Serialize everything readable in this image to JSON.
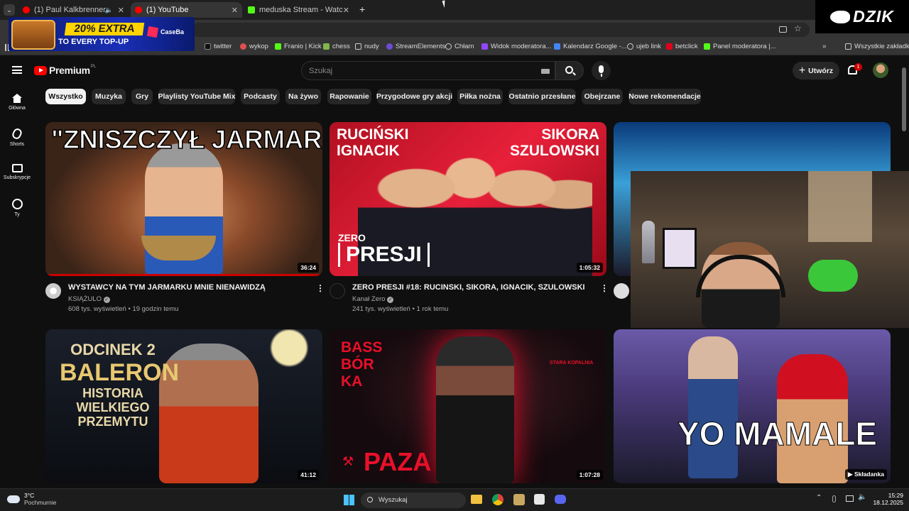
{
  "tabs": [
    {
      "label": "(1) Paul Kalkbrenner - Live a",
      "favicon_color": "#ff0000"
    },
    {
      "label": "(1) YouTube",
      "favicon_color": "#ff0000"
    },
    {
      "label": "meduska Stream - Watch Live o",
      "favicon_color": "#53fc18"
    }
  ],
  "new_tab_label": "+",
  "tab_close_glyph": "✕",
  "overlay": {
    "promo_line1": "20% EXTRA",
    "promo_line2": "TO EVERY TOP-UP",
    "promo_brand": "CaseBa",
    "corner_logo": "DZIK"
  },
  "bookmarks": [
    {
      "label": "twitter",
      "color": "#ffffff"
    },
    {
      "label": "wykop",
      "color": "#e24f4f"
    },
    {
      "label": "Franio | Kick",
      "color": "#53fc18"
    },
    {
      "label": "chess",
      "color": "#81b64c"
    },
    {
      "label": "nudy",
      "color": "#cfcfcf"
    },
    {
      "label": "StreamElements",
      "color": "#6f4bd8"
    },
    {
      "label": "Chłam",
      "color": "#cfcfcf"
    },
    {
      "label": "Widok moderatora...",
      "color": "#9146ff"
    },
    {
      "label": "Kalendarz Google -...",
      "color": "#4285f4"
    },
    {
      "label": "ujeb link",
      "color": "#cfcfcf"
    },
    {
      "label": "betclick",
      "color": "#e2001a"
    },
    {
      "label": "Panel moderatora |...",
      "color": "#53fc18"
    }
  ],
  "bookmarks_all_label": "Wszystkie zakładki",
  "youtube": {
    "logo": "Premium",
    "logo_region": "PL",
    "search_placeholder": "Szukaj",
    "create_label": "Utwórz",
    "notification_count": "1",
    "sidebar": [
      {
        "label": "Główna",
        "icon": "home-icon"
      },
      {
        "label": "Shorts",
        "icon": "shorts-icon"
      },
      {
        "label": "Subskrypcje",
        "icon": "subscriptions-icon"
      },
      {
        "label": "Ty",
        "icon": "you-icon"
      }
    ],
    "chips": [
      "Wszystko",
      "Muzyka",
      "Gry",
      "Playlisty YouTube Mix",
      "Podcasty",
      "Na żywo",
      "Rapowanie",
      "Przygodowe gry akcji",
      "Piłka nożna",
      "Ostatnio przesłane",
      "Obejrzane",
      "Nowe rekomendacje"
    ],
    "videos": [
      {
        "thumb_text": "\"ZNISZCZYŁ JARMARK!\"",
        "duration": "36:24",
        "title": "WYSTAWCY NA TYM JARMARKU MNIE NIENAWIDZĄ",
        "channel": "KSIĄŻULO",
        "meta": "608 tys. wyświetleń • 19 godzin temu",
        "verified": "✓"
      },
      {
        "thumb_text_left": "RUCIŃSKI IGNACIK",
        "thumb_text_right": "SIKORA SZULOWSKI",
        "thumb_brand_small": "ZERO",
        "thumb_brand": "PRESJI",
        "duration": "1:05:32",
        "title": "ZERO PRESJI #18: RUCINSKI, SIKORA, IGNACIK, SZULOWSKI",
        "channel": "Kanał Zero",
        "meta": "241 tys. wyświetleń • 1 rok temu",
        "verified": "✓"
      },
      {
        "thumb_line1": "ODCINEK 2",
        "thumb_line2": "BALERON",
        "thumb_line3": "HISTORIA",
        "thumb_line4": "WIELKIEGO",
        "thumb_line5": "PRZEMYTU",
        "duration": "41:12"
      },
      {
        "thumb_text": "BASS BÓR KA",
        "thumb_sub": "PAZA",
        "thumb_venue": "STARA KOPALNIA",
        "duration": "1:07:28"
      },
      {
        "thumb_text": "YO MAMALE",
        "badge": "Składanka"
      }
    ]
  },
  "taskbar": {
    "weather_temp": "3°C",
    "weather_desc": "Pochmurnie",
    "search_label": "Wyszukaj",
    "time": "15:29",
    "date": "18.12.2025"
  }
}
